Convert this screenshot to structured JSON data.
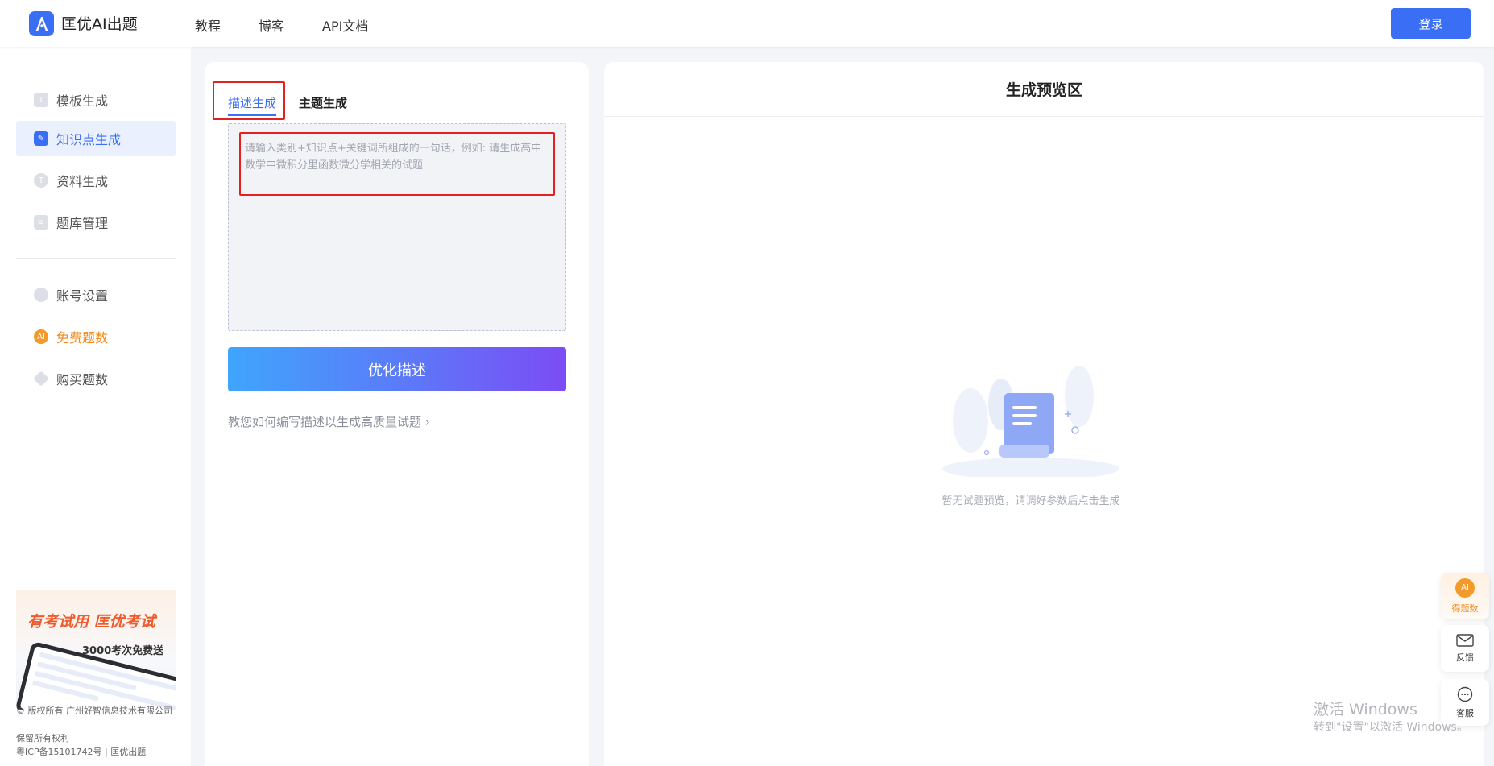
{
  "header": {
    "brand": "匡优AI出题",
    "nav": [
      "教程",
      "博客",
      "API文档"
    ],
    "login_label": "登录"
  },
  "sidebar": {
    "items": [
      {
        "label": "模板生成",
        "icon": "template-icon",
        "active": false
      },
      {
        "label": "知识点生成",
        "icon": "edit-icon",
        "active": true
      },
      {
        "label": "资料生成",
        "icon": "text-icon",
        "active": false
      },
      {
        "label": "题库管理",
        "icon": "database-icon",
        "active": false
      }
    ],
    "items2": [
      {
        "label": "账号设置",
        "icon": "user-icon"
      },
      {
        "label": "免费题数",
        "icon": "ai-coin-icon"
      },
      {
        "label": "购买题数",
        "icon": "diamond-icon"
      }
    ],
    "promo": {
      "title": "有考试用 匡优考试",
      "subtitle": "3000考次免费送"
    },
    "footer": [
      "© 版权所有 广州好智信息技术有限公司",
      "保留所有权利",
      "粤ICP备15101742号 | 匡优出题"
    ]
  },
  "editor": {
    "tabs": [
      "描述生成",
      "主题生成"
    ],
    "placeholder": "请输入类别+知识点+关键词所组成的一句话，例如: 请生成高中数学中微积分里函数微分学相关的试题",
    "optimize_label": "优化描述",
    "help_link": "教您如何编写描述以生成高质量试题",
    "help_chevron": "›"
  },
  "preview": {
    "title": "生成预览区",
    "empty_text": "暂无试题预览，请调好参数后点击生成"
  },
  "floating": {
    "ai_badge": "AI",
    "ai_label": "得题数",
    "feedback_label": "反馈",
    "service_label": "客服"
  },
  "watermark": {
    "line1": "激活 Windows",
    "line2": "转到\"设置\"以激活 Windows。"
  },
  "colors": {
    "accent": "#3a6ff5",
    "orange": "#f28a1d",
    "highlight_red": "#e52020"
  }
}
